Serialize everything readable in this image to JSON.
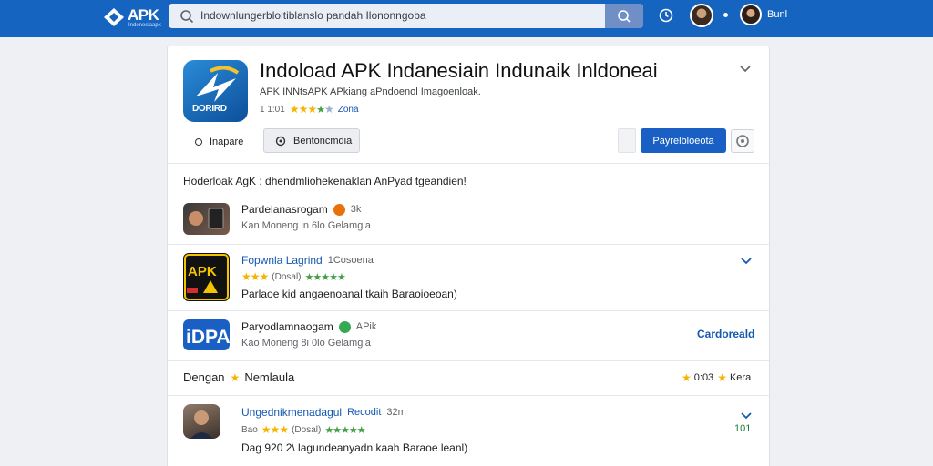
{
  "header": {
    "logo_text": "APK",
    "logo_sub": "Indonesiaapk",
    "search_value": "Indownlungerbloitiblanslo pandah Ilononngoba",
    "user_name": "Bunl"
  },
  "app": {
    "title": "Indoload APK Indanesiain Indunaik Inldoneai",
    "subtitle": "APK INNtsAPK APkiang aPndoenol Imagoenloak.",
    "icon_text": "DORIRD",
    "rating_value": "1 1:01",
    "rating_tag": "Zona",
    "radio_label": "Inapare",
    "secondary_button": "Bentoncmdia",
    "primary_button": "Payrelbloeota"
  },
  "section_title": "Hoderloak AgK : dhendmliohekenaklan AnPyad tgeandien!",
  "items": [
    {
      "name": "Pardelanasrogam",
      "tag": "3k",
      "tag_color": "#e8710a",
      "meta": "Kan Moneng in 6lo   Gelamgia"
    },
    {
      "name": "Fopwnla Lagrind",
      "tag": "1Cosoena",
      "rating_text": "(Dosal)",
      "desc": "Parlaoe kid angaenoanal tkaih  Baraoioeoan)"
    },
    {
      "name": "Paryodlamnaogam",
      "tag": "APik",
      "tag_color": "#34a853",
      "meta": "Kao Moneng 8i 0lo   Gelamgia",
      "action": "Cardoreald"
    }
  ],
  "reviews": {
    "label_prefix": "Dengan",
    "label": "Nemlaula",
    "score": "0:03",
    "score_label": "Kera"
  },
  "review": {
    "name": "Ungednikmenadagul",
    "name_tag": "Recodit",
    "time": "32m",
    "rating_prefix": "Bao",
    "rating_text": "(Dosal)",
    "count": "101",
    "text": "Dag 920 2\\ lagundeanyadn kaah  Baraoe leanl)"
  },
  "colors": {
    "topbar": "#1565c0",
    "primary": "#1a60c4",
    "star": "#f5b400",
    "star_green": "#43a047",
    "link": "#1558b0"
  }
}
